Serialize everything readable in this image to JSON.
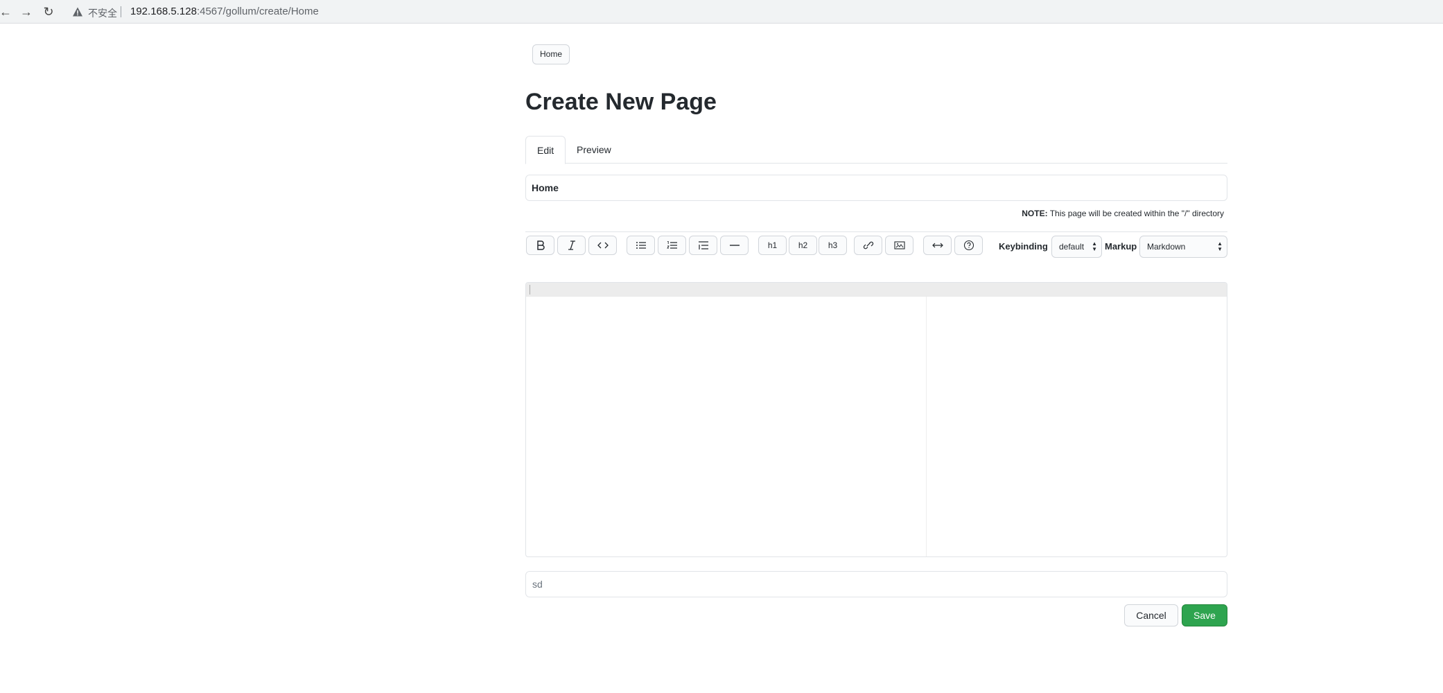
{
  "browser": {
    "insecure_label": "不安全",
    "url_host": "192.168.5.128",
    "url_rest": ":4567/gollum/create/Home"
  },
  "breadcrumb": {
    "home": "Home"
  },
  "page_title": "Create New Page",
  "tabs": [
    {
      "label": "Edit",
      "active": true
    },
    {
      "label": "Preview",
      "active": false
    }
  ],
  "page_name_value": "Home",
  "note": {
    "bold": "NOTE:",
    "text": " This page will be created within the \"/\" directory"
  },
  "toolbar": {
    "h1": "h1",
    "h2": "h2",
    "h3": "h3",
    "keybinding_label": "Keybinding",
    "keybinding_value": "default",
    "markup_label": "Markup",
    "markup_value": "Markdown"
  },
  "commit_message": "sd",
  "buttons": {
    "cancel": "Cancel",
    "save": "Save"
  },
  "colors": {
    "save_green": "#2ea44f",
    "text": "#24292e",
    "border": "#e1e4e8"
  }
}
